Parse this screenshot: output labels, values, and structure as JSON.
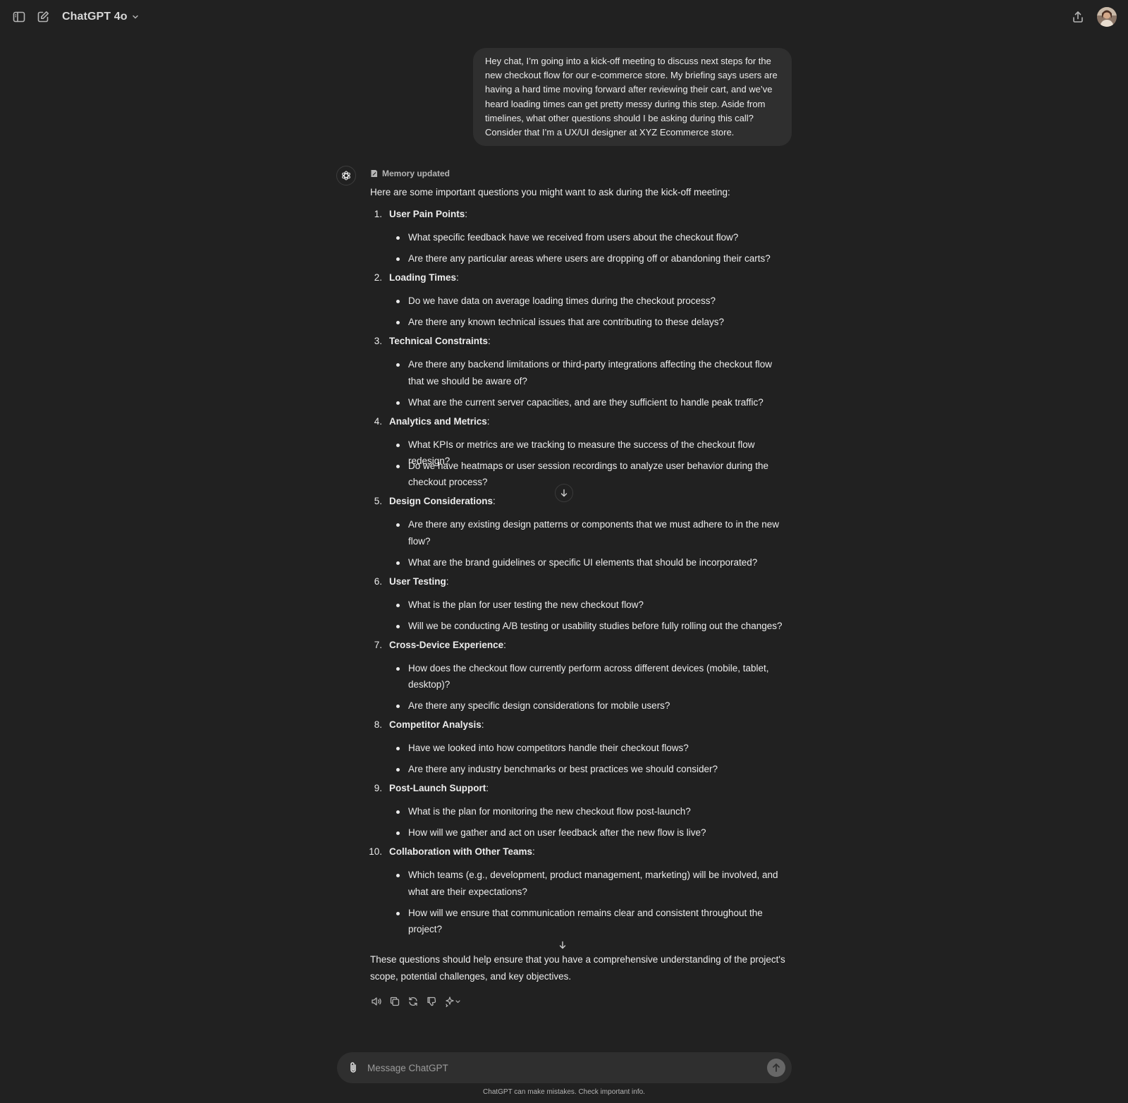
{
  "header": {
    "model_name": "ChatGPT 4o",
    "icons": [
      "sidebar-toggle-icon",
      "new-chat-icon",
      "chevron-down-icon",
      "share-icon",
      "user-avatar"
    ]
  },
  "user_message": "Hey chat, I’m going into a kick-off meeting to discuss next steps for the new checkout flow for our e-commerce store. My briefing says users are having a hard time moving forward after reviewing their cart, and we’ve heard loading times can get pretty messy during this step. Aside from timelines, what other questions should I be asking during this call? Consider that I’m a UX/UI designer at XYZ Ecommerce store.",
  "assistant": {
    "memory_label": "Memory updated",
    "intro": "Here are some important questions you might want to ask during the kick-off meeting:",
    "sections": [
      {
        "num": "1.",
        "title": "User Pain Points",
        "suffix": ":",
        "bullets": [
          {
            "lines": [
              "What specific feedback have we received from users about the checkout flow?"
            ]
          },
          {
            "lines": [
              "Are there any particular areas where users are dropping off or abandoning their carts?"
            ]
          }
        ]
      },
      {
        "num": "2.",
        "title": "Loading Times",
        "suffix": ":",
        "bullets": [
          {
            "lines": [
              "Do we have data on average loading times during the checkout process?"
            ]
          },
          {
            "lines": [
              "Are there any known technical issues that are contributing to these delays?"
            ]
          }
        ]
      },
      {
        "num": "3.",
        "title": "Technical Constraints",
        "suffix": ":",
        "bullets": [
          {
            "lines": [
              "Are there any backend limitations or third-party integrations affecting the checkout flow",
              "that we should be aware of?"
            ]
          },
          {
            "lines": [
              "What are the current server capacities, and are they sufficient to handle peak traffic?"
            ]
          }
        ]
      },
      {
        "num": "4.",
        "title": "Analytics and Metrics",
        "suffix": ":",
        "bullets": [
          {
            "lines": [
              "What KPIs or metrics are we tracking to measure the success of the checkout flow redesign?"
            ]
          },
          {
            "lines": [
              "Do we have heatmaps or user session recordings to analyze user behavior during the",
              "checkout process?"
            ]
          }
        ]
      },
      {
        "num": "5.",
        "title": "Design Considerations",
        "suffix": ":",
        "bullets": [
          {
            "lines": [
              "Are there any existing design patterns or components that we must adhere to in the new",
              "flow?"
            ]
          },
          {
            "lines": [
              "What are the brand guidelines or specific UI elements that should be incorporated?"
            ]
          }
        ]
      },
      {
        "num": "6.",
        "title": "User Testing",
        "suffix": ":",
        "bullets": [
          {
            "lines": [
              "What is the plan for user testing the new checkout flow?"
            ]
          },
          {
            "lines": [
              "Will we be conducting A/B testing or usability studies before fully rolling out the changes?"
            ]
          }
        ]
      },
      {
        "num": "7.",
        "title": "Cross-Device Experience",
        "suffix": ":",
        "bullets": [
          {
            "lines": [
              "How does the checkout flow currently perform across different devices (mobile, tablet,",
              "desktop)?"
            ]
          },
          {
            "lines": [
              "Are there any specific design considerations for mobile users?"
            ]
          }
        ]
      },
      {
        "num": "8.",
        "title": "Competitor Analysis",
        "suffix": ":",
        "bullets": [
          {
            "lines": [
              "Have we looked into how competitors handle their checkout flows?"
            ]
          },
          {
            "lines": [
              "Are there any industry benchmarks or best practices we should consider?"
            ]
          }
        ]
      },
      {
        "num": "9.",
        "title": "Post-Launch Support",
        "suffix": ":",
        "bullets": [
          {
            "lines": [
              "What is the plan for monitoring the new checkout flow post-launch?"
            ]
          },
          {
            "lines": [
              "How will we gather and act on user feedback after the new flow is live?"
            ]
          }
        ]
      },
      {
        "num": "10.",
        "title": "Collaboration with Other Teams",
        "suffix": ":",
        "bullets": [
          {
            "lines": [
              "Which teams (e.g., development, product management, marketing) will be involved, and",
              "what are their expectations?"
            ]
          },
          {
            "lines": [
              "How will we ensure that communication remains clear and consistent throughout the",
              "project?"
            ]
          }
        ]
      }
    ],
    "outro_lines": [
      "These questions should help ensure that you have a comprehensive understanding of the project's",
      "scope, potential challenges, and key objectives."
    ],
    "action_icons": [
      "read-aloud-icon",
      "copy-icon",
      "regenerate-icon",
      "thumbs-down-icon",
      "sparkle-model-icon"
    ]
  },
  "composer": {
    "placeholder": "Message ChatGPT",
    "disclaimer": "ChatGPT can make mistakes. Check important info."
  },
  "colors": {
    "background": "#212121",
    "bubble": "#2f2f2f",
    "text": "#ececec",
    "muted": "#b4b4b4"
  }
}
